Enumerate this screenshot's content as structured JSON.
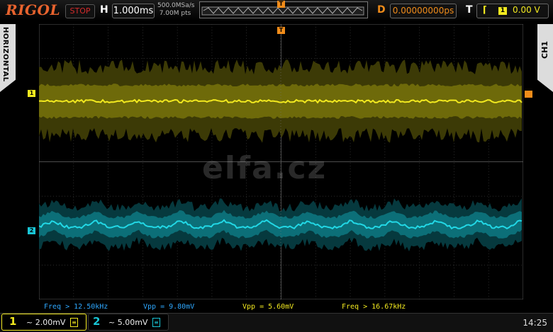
{
  "header": {
    "brand": "RIGOL",
    "run_state": "STOP",
    "h_label": "H",
    "timebase": "1.000ms",
    "sample_rate": "500.0MSa/s",
    "memory_depth": "7.00M pts",
    "d_label": "D",
    "trigger_delay": "0.00000000ps",
    "t_label": "T",
    "trigger_source": "1",
    "trigger_level": "0.00 V"
  },
  "side": {
    "left_menu": "HORIZONTAL",
    "right_menu": "CH1"
  },
  "markers": {
    "ch1": "1",
    "ch2": "2",
    "trigger": "T"
  },
  "measurements": [
    {
      "text": "Freq > 12.50kHz",
      "color": "#2ea8ff"
    },
    {
      "text": "Vpp = 9.80mV",
      "color": "#2ea8ff"
    },
    {
      "text": "Vpp = 5.60mV",
      "color": "#f2e91f"
    },
    {
      "text": "Freq > 16.67kHz",
      "color": "#f2e91f"
    }
  ],
  "channels": [
    {
      "num": "1",
      "scale": "~ 2.00mV",
      "color": "#f2e91f"
    },
    {
      "num": "2",
      "scale": "~ 5.00mV",
      "color": "#19c6d6"
    }
  ],
  "clock": "14:25",
  "watermark": "elfa.cz",
  "colors": {
    "ch1": "#f2e91f",
    "ch2": "#19c6d6",
    "trigger": "#f08c1a",
    "brand": "#e8632e"
  }
}
